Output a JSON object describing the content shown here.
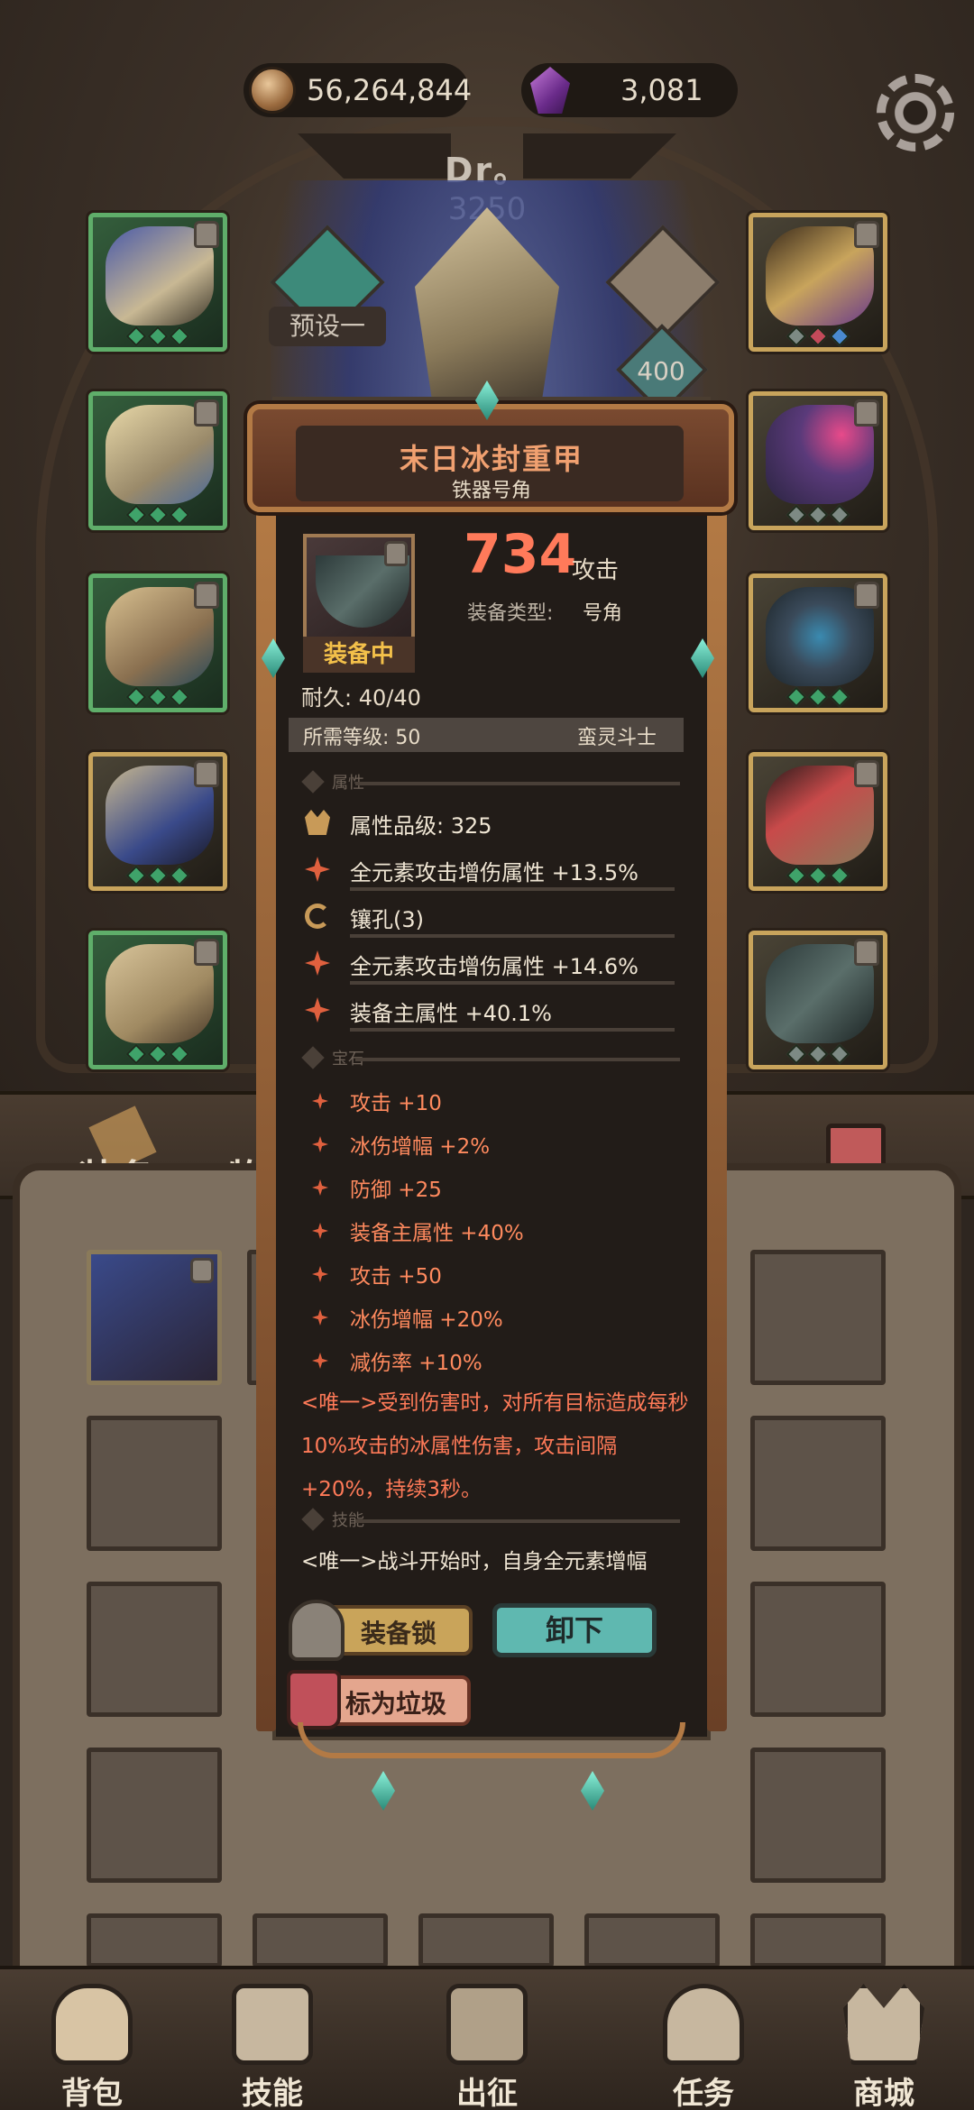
{
  "currency": {
    "gold": "56,264,844",
    "gems": "3,081"
  },
  "character": {
    "name": "Dr。",
    "power": "3250",
    "preset_label": "预设一",
    "slot_badge": "400"
  },
  "tooltip": {
    "title": "末日冰封重甲",
    "subtitle": "铁器号角",
    "equipped_tag": "装备中",
    "attack_value": "734",
    "attack_unit": "攻击",
    "type_label": "装备类型:",
    "type_value": "号角",
    "durability": "耐久: 40/40",
    "required_level": "所需等级: 50",
    "required_class": "蛮灵斗士",
    "section_attributes": "属性",
    "section_gems": "宝石",
    "section_skills": "技能",
    "attributes": [
      {
        "icon": "crown-icon",
        "text": "属性品级: 325"
      },
      {
        "icon": "spark-icon",
        "text": "全元素攻击增伤属性 +13.5%"
      },
      {
        "icon": "socket-icon",
        "text": "镶孔(3)"
      },
      {
        "icon": "spark-icon",
        "text": "全元素攻击增伤属性 +14.6%"
      },
      {
        "icon": "spark-icon",
        "text": "装备主属性 +40.1%"
      }
    ],
    "gems": [
      "攻击 +10",
      "冰伤增幅 +2%",
      "防御 +25",
      "装备主属性 +40%",
      "攻击 +50",
      "冰伤增幅 +20%",
      "减伤率 +10%"
    ],
    "unique_effect": "<唯一>受到伤害时，对所有目标造成每秒10%攻击的冰属性伤害，攻击间隔+20%，持续3秒。",
    "skill_effect": "<唯一>战斗开始时，自身全元素增幅",
    "lock_button": "装备锁",
    "unequip_button": "卸下",
    "junk_button": "标为垃圾"
  },
  "bag_tabs": {
    "equipment": "装备",
    "items": "物品"
  },
  "nav": [
    {
      "label": "背包",
      "icon": "backpack-icon"
    },
    {
      "label": "技能",
      "icon": "skill-book-icon"
    },
    {
      "label": "出征",
      "icon": "battle-map-icon"
    },
    {
      "label": "任务",
      "icon": "quest-icon"
    },
    {
      "label": "商城",
      "icon": "shop-icon"
    }
  ],
  "colors": {
    "accent_red": "#ff7a5a",
    "gem_text": "#ff8a5e",
    "equipped_gold": "#f3c04a",
    "unequip_teal": "#5fb8b0"
  }
}
